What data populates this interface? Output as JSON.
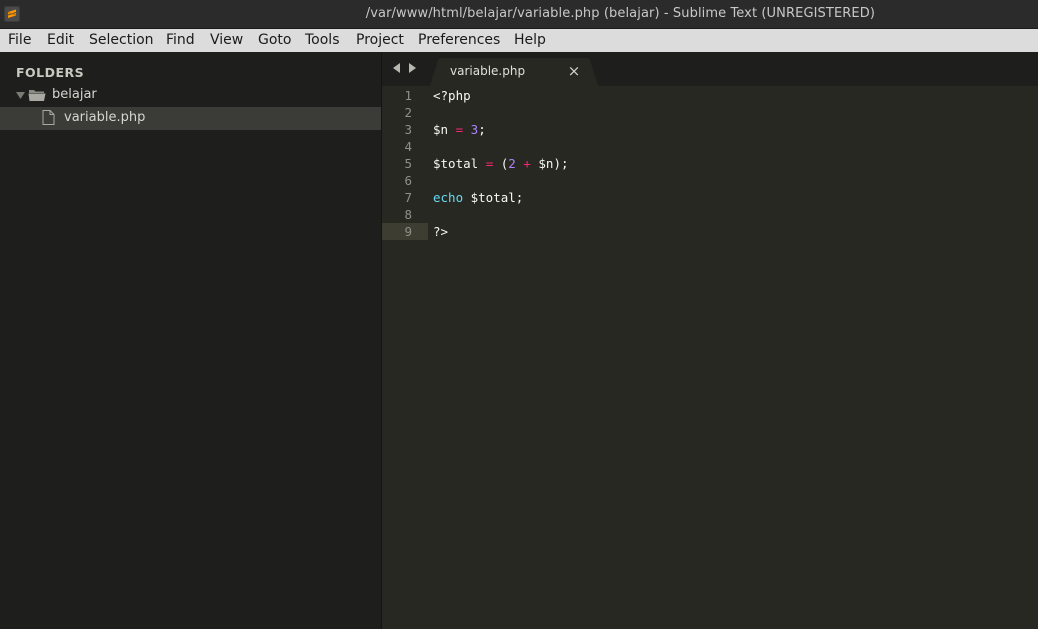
{
  "window": {
    "title": "/var/www/html/belajar/variable.php (belajar) - Sublime Text (UNREGISTERED)",
    "app_icon": "sublime-text-icon"
  },
  "menu": {
    "items": [
      "File",
      "Edit",
      "Selection",
      "Find",
      "View",
      "Goto",
      "Tools",
      "Project",
      "Preferences",
      "Help"
    ]
  },
  "sidebar": {
    "header": "FOLDERS",
    "folder": "belajar",
    "file": "variable.php"
  },
  "tabs": [
    {
      "label": "variable.php",
      "close": "×"
    }
  ],
  "editor": {
    "active_line": 9,
    "line_numbers": [
      "1",
      "2",
      "3",
      "4",
      "5",
      "6",
      "7",
      "8",
      "9"
    ],
    "lines": [
      {
        "tokens": [
          {
            "t": "<?php",
            "c": "var"
          }
        ]
      },
      {
        "tokens": []
      },
      {
        "tokens": [
          {
            "t": "$n",
            "c": "var"
          },
          {
            "t": " ",
            "c": "var"
          },
          {
            "t": "=",
            "c": "op"
          },
          {
            "t": " ",
            "c": "var"
          },
          {
            "t": "3",
            "c": "num"
          },
          {
            "t": ";",
            "c": "var"
          }
        ]
      },
      {
        "tokens": []
      },
      {
        "tokens": [
          {
            "t": "$total",
            "c": "var"
          },
          {
            "t": " ",
            "c": "var"
          },
          {
            "t": "=",
            "c": "op"
          },
          {
            "t": " (",
            "c": "var"
          },
          {
            "t": "2",
            "c": "num"
          },
          {
            "t": " ",
            "c": "var"
          },
          {
            "t": "+",
            "c": "op"
          },
          {
            "t": " $n);",
            "c": "var"
          }
        ]
      },
      {
        "tokens": []
      },
      {
        "tokens": [
          {
            "t": "echo",
            "c": "kw"
          },
          {
            "t": " $total;",
            "c": "var"
          }
        ]
      },
      {
        "tokens": []
      },
      {
        "tokens": [
          {
            "t": "?>",
            "c": "var"
          }
        ]
      }
    ]
  },
  "colors": {
    "background": "#272822",
    "sidebar": "#1e1f1c",
    "keyword": "#66d9ef",
    "operator": "#f92672",
    "number": "#ae81ff",
    "text": "#f8f8f2"
  }
}
